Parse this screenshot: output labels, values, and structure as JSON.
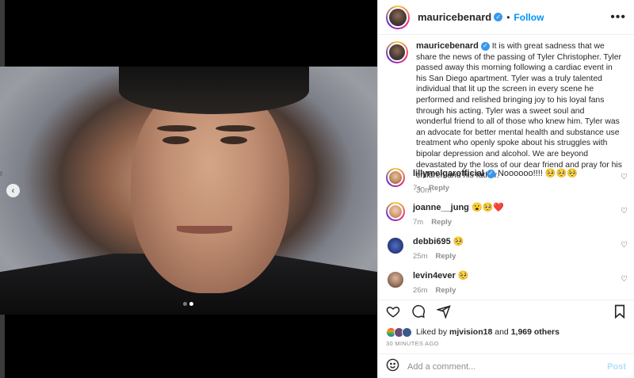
{
  "post": {
    "username": "mauricebenard",
    "follow_label": "Follow",
    "separator": "•",
    "more_icon": "more-horizontal-icon",
    "verified_mark": "✓"
  },
  "caption": {
    "username": "mauricebenard",
    "text": "It is with great sadness that we share the news of the passing of Tyler Christopher. Tyler passed away this morning following a cardiac event in his San Diego apartment. Tyler was a truly talented individual that lit up the screen in every scene he performed and relished bringing joy to his loyal fans through his acting. Tyler was a sweet soul and wonderful friend to all of those who knew him. Tyler was an advocate for better mental health and substance use treatment who openly spoke about his struggles with bipolar depression and alcohol. We are beyond devastated by the loss of our dear friend and pray for his children and his father.",
    "time": "30m"
  },
  "comments": [
    {
      "username": "lillymelgarofficial",
      "text": "Noooooo!!!! 🥺🥺🥺",
      "time": "7s",
      "reply": "Reply"
    },
    {
      "username": "joanne__jung",
      "text": "😮🥺❤️",
      "time": "7m",
      "reply": "Reply"
    },
    {
      "username": "debbi695",
      "text": "🥺",
      "time": "25m",
      "reply": "Reply"
    },
    {
      "username": "levin4ever",
      "text": "🥺",
      "time": "26m",
      "reply": "Reply"
    }
  ],
  "likes": {
    "prefix": "Liked by",
    "user": "mjvision18",
    "middle": "and",
    "count": "1,969 others",
    "timestamp": "30 MINUTES AGO"
  },
  "add_comment": {
    "placeholder": "Add a comment...",
    "post_label": "Post"
  },
  "carousel": {
    "slide_count": 2,
    "active_slide": 2
  },
  "colors": {
    "accent": "#0095f6",
    "verified": "#3897f0",
    "muted": "#8e8e8e"
  }
}
